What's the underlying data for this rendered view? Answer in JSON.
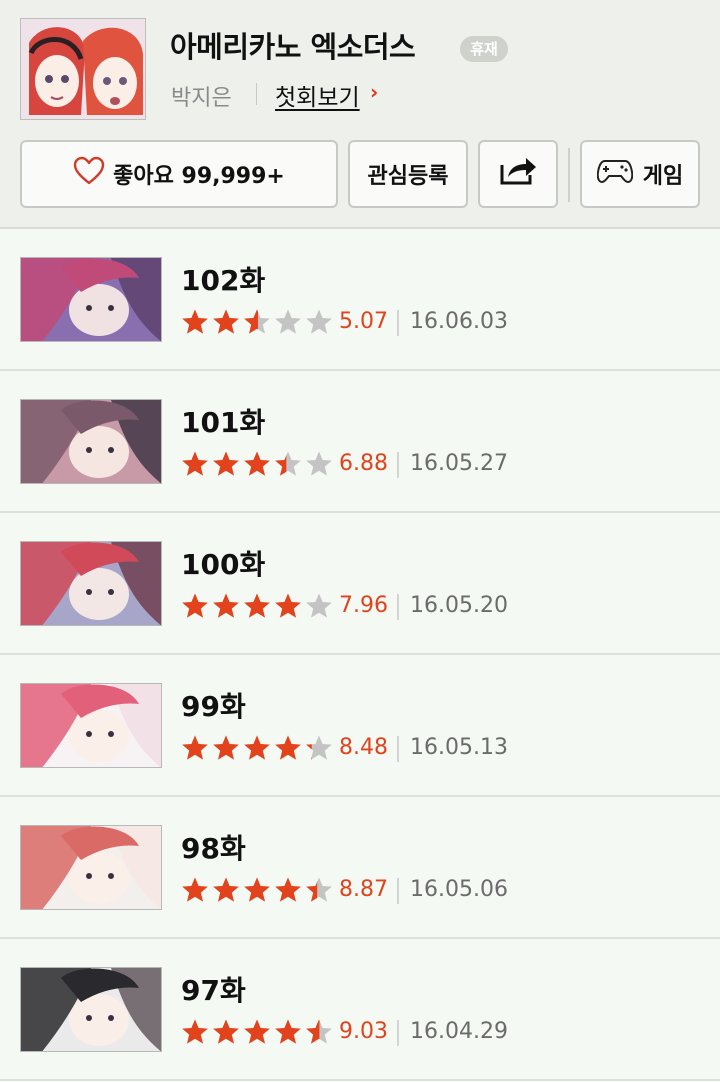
{
  "header": {
    "title": "아메리카노 엑소더스",
    "badge": "휴재",
    "author": "박지은",
    "first_episode_label": "첫회보기",
    "first_episode_arrow": "›",
    "like_label": "좋아요 99,999+",
    "favorite_label": "관심등록",
    "game_label": "게임"
  },
  "episodes": [
    {
      "title": "102화",
      "rating": "5.07",
      "date": "16.06.03",
      "rating_value": 5.07,
      "thumb_colors": [
        "#5a3f6a",
        "#c04a78",
        "#8a6fb0"
      ]
    },
    {
      "title": "101화",
      "rating": "6.88",
      "date": "16.05.27",
      "rating_value": 6.88,
      "thumb_colors": [
        "#3a3040",
        "#7a5a6a",
        "#c89aa8"
      ]
    },
    {
      "title": "100화",
      "rating": "7.96",
      "date": "16.05.20",
      "rating_value": 7.96,
      "thumb_colors": [
        "#6b3a48",
        "#d04a5a",
        "#a8a6c8"
      ]
    },
    {
      "title": "99화",
      "rating": "8.48",
      "date": "16.05.13",
      "rating_value": 8.48,
      "thumb_colors": [
        "#f0dde4",
        "#e2607a",
        "#f7f2f4"
      ]
    },
    {
      "title": "98화",
      "rating": "8.87",
      "date": "16.05.06",
      "rating_value": 8.87,
      "thumb_colors": [
        "#f6e7e2",
        "#d96a66",
        "#f3efed"
      ]
    },
    {
      "title": "97화",
      "rating": "9.03",
      "date": "16.04.29",
      "rating_value": 9.03,
      "thumb_colors": [
        "#5a5056",
        "#2a2a2e",
        "#eaeaea"
      ]
    }
  ],
  "colors": {
    "accent": "#e0441e",
    "star_filled": "#e3431c",
    "star_empty": "#c4c4c4",
    "date": "#6b6b6b"
  },
  "icons": {
    "like": "heart-outline-icon",
    "share": "share-out-icon",
    "game": "gamepad-icon"
  }
}
